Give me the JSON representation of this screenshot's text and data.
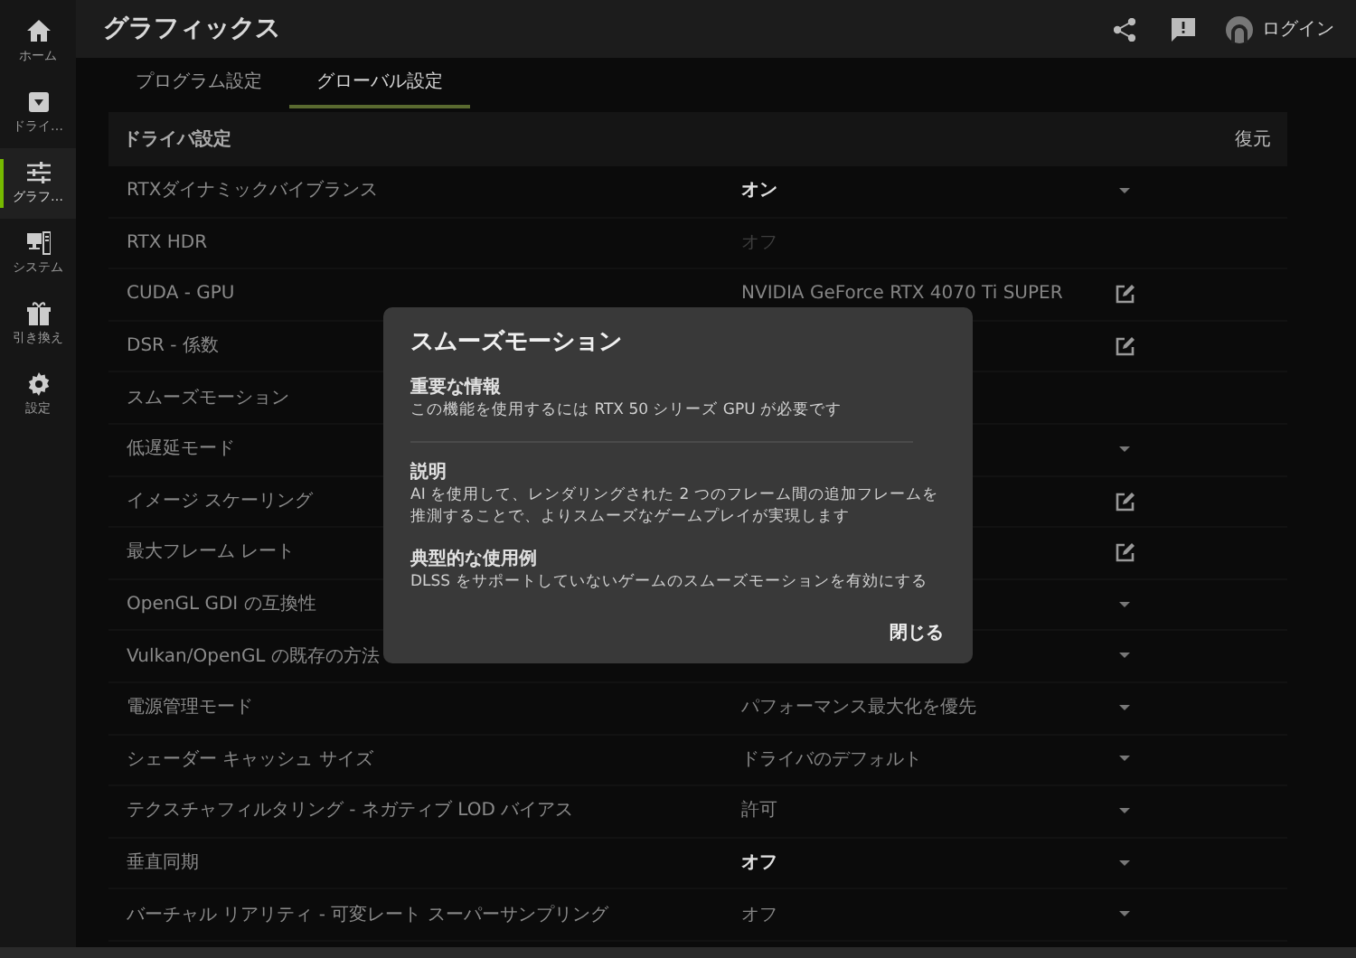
{
  "sidebar": {
    "items": [
      {
        "label": "ホーム",
        "kind": "home",
        "selected": false
      },
      {
        "label": "ドライ…",
        "kind": "driver",
        "selected": false
      },
      {
        "label": "グラフ…",
        "kind": "sliders",
        "selected": true
      },
      {
        "label": "システム",
        "kind": "system",
        "selected": false
      },
      {
        "label": "引き換え",
        "kind": "gift",
        "selected": false
      },
      {
        "label": "設定",
        "kind": "gear",
        "selected": false
      }
    ]
  },
  "header": {
    "title": "グラフィックス",
    "login": "ログイン"
  },
  "tabs": [
    {
      "label": "プログラム設定",
      "selected": false
    },
    {
      "label": "グローバル設定",
      "selected": true
    }
  ],
  "section": {
    "title": "ドライバ設定",
    "restore": "復元"
  },
  "settings": [
    {
      "label": "RTXダイナミックバイブランス",
      "value": "オン",
      "kind": "dropdown",
      "modified": true,
      "disabled": false
    },
    {
      "label": "RTX HDR",
      "value": "オフ",
      "kind": "plain",
      "disabled": true
    },
    {
      "label": "CUDA - GPU",
      "value": "NVIDIA GeForce RTX 4070 Ti SUPER",
      "kind": "edit",
      "modified": false,
      "disabled": false
    },
    {
      "label": "DSR - 係数",
      "kind": "edit"
    },
    {
      "label": "スムーズモーション",
      "kind": "plain"
    },
    {
      "label": "低遅延モード",
      "kind": "dropdown"
    },
    {
      "label": "イメージ スケーリング",
      "kind": "edit"
    },
    {
      "label": "最大フレーム レート",
      "kind": "edit"
    },
    {
      "label": "OpenGL GDI の互換性",
      "kind": "dropdown"
    },
    {
      "label": "Vulkan/OpenGL の既存の方法",
      "kind": "dropdown"
    },
    {
      "label": "電源管理モード",
      "value": "パフォーマンス最大化を優先",
      "kind": "dropdown",
      "modified": false,
      "disabled": false
    },
    {
      "label": "シェーダー キャッシュ サイズ",
      "value": "ドライバのデフォルト",
      "kind": "dropdown",
      "modified": false,
      "disabled": false
    },
    {
      "label": "テクスチャフィルタリング - ネガティブ LOD バイアス",
      "value": "許可",
      "kind": "dropdown",
      "modified": false,
      "disabled": false
    },
    {
      "label": "垂直同期",
      "value": "オフ",
      "kind": "dropdown",
      "modified": true,
      "disabled": false
    },
    {
      "label": "バーチャル リアリティ - 可変レート スーパーサンプリング",
      "value": "オフ",
      "kind": "dropdown",
      "modified": false,
      "disabled": false
    }
  ],
  "dialog": {
    "title": "スムーズモーション",
    "sections": [
      {
        "heading": "重要な情報",
        "body": "この機能を使用するには RTX 50 シリーズ GPU が必要です"
      },
      {
        "heading": "説明",
        "body": "AI を使用して、レンダリングされた 2 つのフレーム間の追加フレームを推測することで、よりスムーズなゲームプレイが実現します"
      },
      {
        "heading": "典型的な使用例",
        "body": "DLSS をサポートしていないゲームのスムーズモーションを有効にする"
      }
    ],
    "close": "閉じる"
  }
}
